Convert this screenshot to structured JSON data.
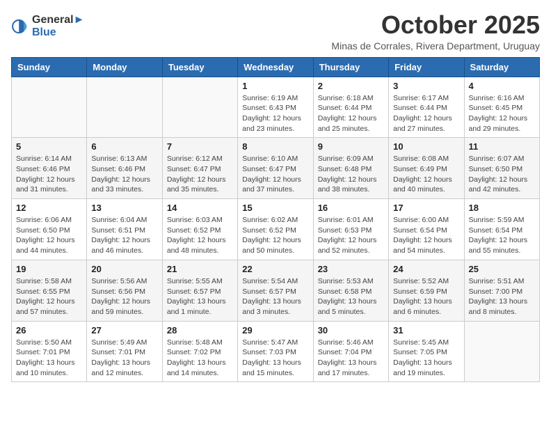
{
  "header": {
    "logo_line1": "General",
    "logo_line2": "Blue",
    "month_title": "October 2025",
    "subtitle": "Minas de Corrales, Rivera Department, Uruguay"
  },
  "days_of_week": [
    "Sunday",
    "Monday",
    "Tuesday",
    "Wednesday",
    "Thursday",
    "Friday",
    "Saturday"
  ],
  "weeks": [
    [
      {
        "day": "",
        "info": ""
      },
      {
        "day": "",
        "info": ""
      },
      {
        "day": "",
        "info": ""
      },
      {
        "day": "1",
        "info": "Sunrise: 6:19 AM\nSunset: 6:43 PM\nDaylight: 12 hours\nand 23 minutes."
      },
      {
        "day": "2",
        "info": "Sunrise: 6:18 AM\nSunset: 6:44 PM\nDaylight: 12 hours\nand 25 minutes."
      },
      {
        "day": "3",
        "info": "Sunrise: 6:17 AM\nSunset: 6:44 PM\nDaylight: 12 hours\nand 27 minutes."
      },
      {
        "day": "4",
        "info": "Sunrise: 6:16 AM\nSunset: 6:45 PM\nDaylight: 12 hours\nand 29 minutes."
      }
    ],
    [
      {
        "day": "5",
        "info": "Sunrise: 6:14 AM\nSunset: 6:46 PM\nDaylight: 12 hours\nand 31 minutes."
      },
      {
        "day": "6",
        "info": "Sunrise: 6:13 AM\nSunset: 6:46 PM\nDaylight: 12 hours\nand 33 minutes."
      },
      {
        "day": "7",
        "info": "Sunrise: 6:12 AM\nSunset: 6:47 PM\nDaylight: 12 hours\nand 35 minutes."
      },
      {
        "day": "8",
        "info": "Sunrise: 6:10 AM\nSunset: 6:47 PM\nDaylight: 12 hours\nand 37 minutes."
      },
      {
        "day": "9",
        "info": "Sunrise: 6:09 AM\nSunset: 6:48 PM\nDaylight: 12 hours\nand 38 minutes."
      },
      {
        "day": "10",
        "info": "Sunrise: 6:08 AM\nSunset: 6:49 PM\nDaylight: 12 hours\nand 40 minutes."
      },
      {
        "day": "11",
        "info": "Sunrise: 6:07 AM\nSunset: 6:50 PM\nDaylight: 12 hours\nand 42 minutes."
      }
    ],
    [
      {
        "day": "12",
        "info": "Sunrise: 6:06 AM\nSunset: 6:50 PM\nDaylight: 12 hours\nand 44 minutes."
      },
      {
        "day": "13",
        "info": "Sunrise: 6:04 AM\nSunset: 6:51 PM\nDaylight: 12 hours\nand 46 minutes."
      },
      {
        "day": "14",
        "info": "Sunrise: 6:03 AM\nSunset: 6:52 PM\nDaylight: 12 hours\nand 48 minutes."
      },
      {
        "day": "15",
        "info": "Sunrise: 6:02 AM\nSunset: 6:52 PM\nDaylight: 12 hours\nand 50 minutes."
      },
      {
        "day": "16",
        "info": "Sunrise: 6:01 AM\nSunset: 6:53 PM\nDaylight: 12 hours\nand 52 minutes."
      },
      {
        "day": "17",
        "info": "Sunrise: 6:00 AM\nSunset: 6:54 PM\nDaylight: 12 hours\nand 54 minutes."
      },
      {
        "day": "18",
        "info": "Sunrise: 5:59 AM\nSunset: 6:54 PM\nDaylight: 12 hours\nand 55 minutes."
      }
    ],
    [
      {
        "day": "19",
        "info": "Sunrise: 5:58 AM\nSunset: 6:55 PM\nDaylight: 12 hours\nand 57 minutes."
      },
      {
        "day": "20",
        "info": "Sunrise: 5:56 AM\nSunset: 6:56 PM\nDaylight: 12 hours\nand 59 minutes."
      },
      {
        "day": "21",
        "info": "Sunrise: 5:55 AM\nSunset: 6:57 PM\nDaylight: 13 hours\nand 1 minute."
      },
      {
        "day": "22",
        "info": "Sunrise: 5:54 AM\nSunset: 6:57 PM\nDaylight: 13 hours\nand 3 minutes."
      },
      {
        "day": "23",
        "info": "Sunrise: 5:53 AM\nSunset: 6:58 PM\nDaylight: 13 hours\nand 5 minutes."
      },
      {
        "day": "24",
        "info": "Sunrise: 5:52 AM\nSunset: 6:59 PM\nDaylight: 13 hours\nand 6 minutes."
      },
      {
        "day": "25",
        "info": "Sunrise: 5:51 AM\nSunset: 7:00 PM\nDaylight: 13 hours\nand 8 minutes."
      }
    ],
    [
      {
        "day": "26",
        "info": "Sunrise: 5:50 AM\nSunset: 7:01 PM\nDaylight: 13 hours\nand 10 minutes."
      },
      {
        "day": "27",
        "info": "Sunrise: 5:49 AM\nSunset: 7:01 PM\nDaylight: 13 hours\nand 12 minutes."
      },
      {
        "day": "28",
        "info": "Sunrise: 5:48 AM\nSunset: 7:02 PM\nDaylight: 13 hours\nand 14 minutes."
      },
      {
        "day": "29",
        "info": "Sunrise: 5:47 AM\nSunset: 7:03 PM\nDaylight: 13 hours\nand 15 minutes."
      },
      {
        "day": "30",
        "info": "Sunrise: 5:46 AM\nSunset: 7:04 PM\nDaylight: 13 hours\nand 17 minutes."
      },
      {
        "day": "31",
        "info": "Sunrise: 5:45 AM\nSunset: 7:05 PM\nDaylight: 13 hours\nand 19 minutes."
      },
      {
        "day": "",
        "info": ""
      }
    ]
  ]
}
